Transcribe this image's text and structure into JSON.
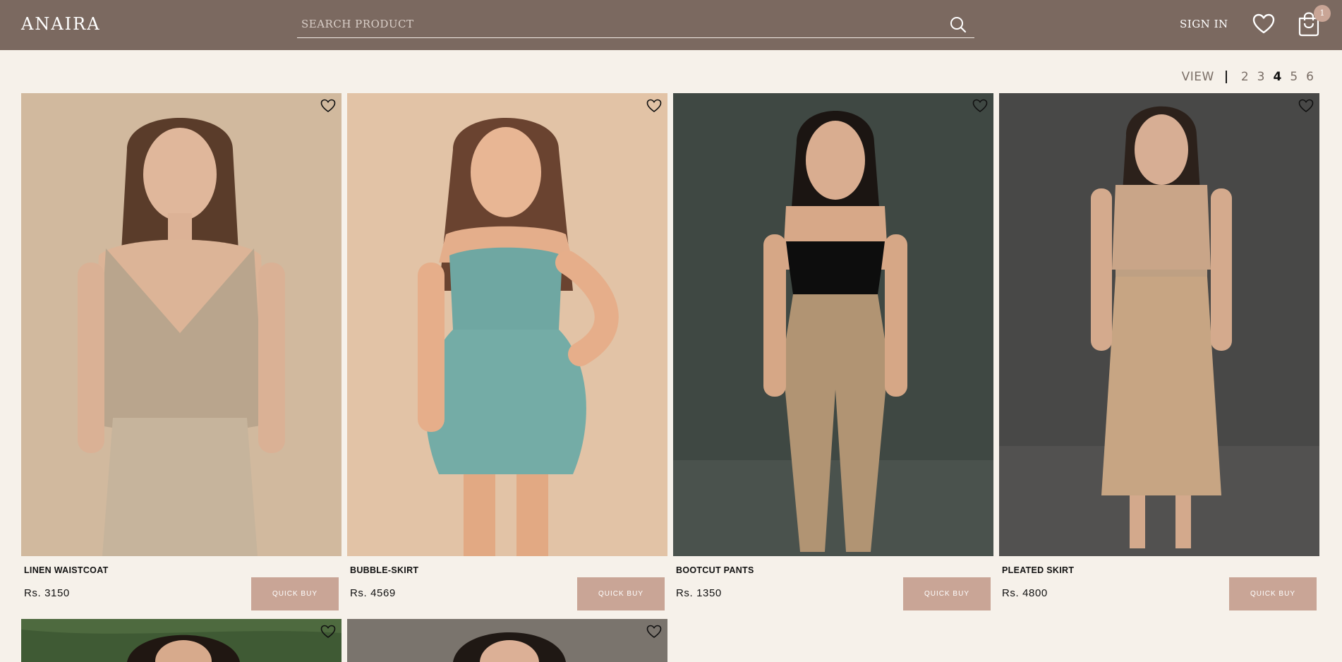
{
  "header": {
    "logo": "ANAIRA",
    "search": {
      "placeholder": "SEARCH PRODUCT",
      "value": ""
    },
    "sign_in_label": "SIGN IN",
    "cart_count": "1",
    "icons": {
      "search": "search-icon",
      "wishlist": "heart-icon",
      "cart": "shopping-bag-icon"
    }
  },
  "view": {
    "label": "VIEW",
    "options": [
      "2",
      "3",
      "4",
      "5",
      "6"
    ],
    "selected": "4"
  },
  "products": [
    {
      "name": "LINEN WAISTCOAT",
      "price": "Rs. 3150",
      "button": "QUICK BUY"
    },
    {
      "name": "BUBBLE-SKIRT",
      "price": "Rs. 4569",
      "button": "QUICK BUY"
    },
    {
      "name": "BOOTCUT PANTS",
      "price": "Rs. 1350",
      "button": "QUICK BUY"
    },
    {
      "name": "PLEATED SKIRT",
      "price": "Rs. 4800",
      "button": "QUICK BUY"
    }
  ],
  "colors": {
    "header_bg": "#7b6960",
    "page_bg": "#f6f1ea",
    "button_bg": "#c9a596"
  }
}
